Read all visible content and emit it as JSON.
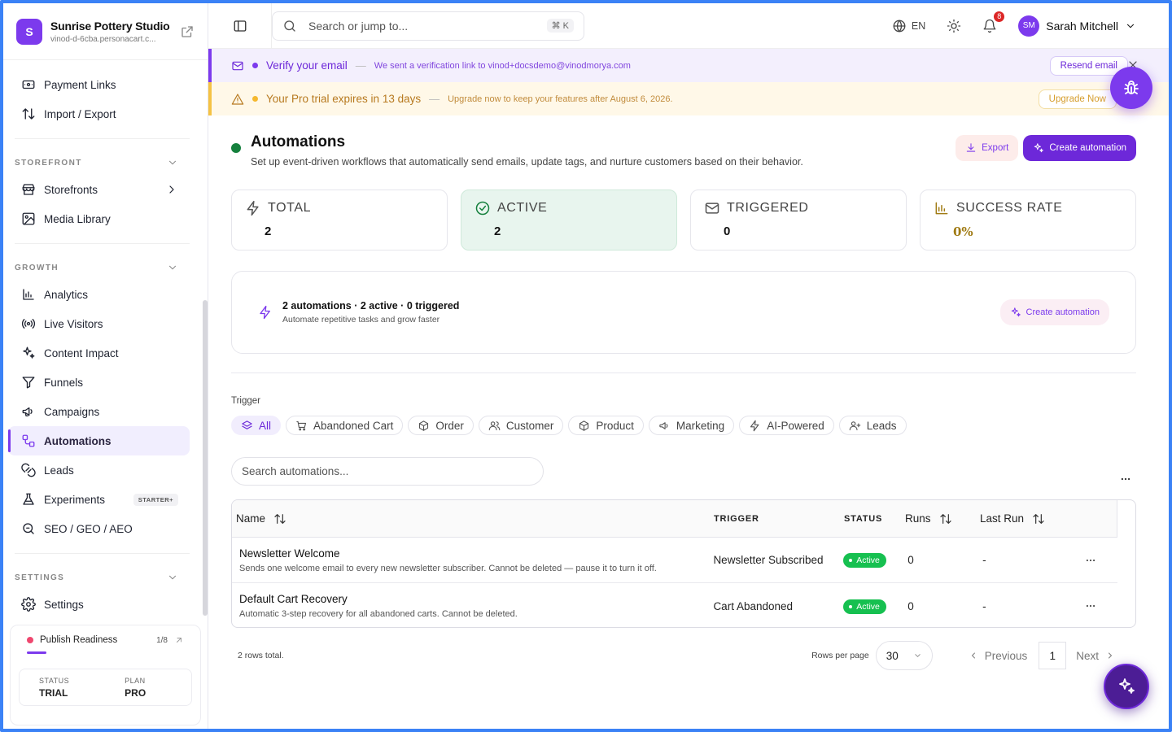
{
  "brand": {
    "initial": "S",
    "name": "Sunrise Pottery Studio",
    "url": "vinod-d-6cba.personacart.c..."
  },
  "sidebar": {
    "top_items": [
      {
        "label": "Payment Links",
        "icon": "payment-link-icon"
      },
      {
        "label": "Import / Export",
        "icon": "arrows-updown-icon"
      }
    ],
    "storefront_label": "STOREFRONT",
    "storefront_items": [
      {
        "label": "Storefronts",
        "icon": "store-icon"
      },
      {
        "label": "Media Library",
        "icon": "image-icon"
      }
    ],
    "growth_label": "GROWTH",
    "growth_items": [
      {
        "label": "Analytics",
        "icon": "bar-chart-icon"
      },
      {
        "label": "Live Visitors",
        "icon": "broadcast-icon"
      },
      {
        "label": "Content Impact",
        "icon": "sparkles-icon"
      },
      {
        "label": "Funnels",
        "icon": "funnel-icon"
      },
      {
        "label": "Campaigns",
        "icon": "megaphone-icon"
      },
      {
        "label": "Automations",
        "icon": "workflow-icon",
        "active": true
      },
      {
        "label": "Leads",
        "icon": "magnet-icon"
      },
      {
        "label": "Experiments",
        "icon": "flask-icon",
        "badge": "STARTER+"
      },
      {
        "label": "SEO / GEO / AEO",
        "icon": "search-icon"
      }
    ],
    "settings_label": "SETTINGS",
    "settings_items": [
      {
        "label": "Settings",
        "icon": "gear-icon"
      }
    ],
    "publish": {
      "title": "Publish Readiness",
      "count": "1/8",
      "status_key": "STATUS",
      "status_val": "TRIAL",
      "plan_key": "PLAN",
      "plan_val": "PRO"
    }
  },
  "topbar": {
    "search_placeholder": "Search or jump to...",
    "shortcut": "⌘ K",
    "language": "EN",
    "notif_count": "8",
    "user_initials": "SM",
    "user_name": "Sarah Mitchell"
  },
  "banners": {
    "verify": {
      "title": "Verify your email",
      "sep": "—",
      "sub": "We sent a verification link to vinod+docsdemo@vinodmorya.com",
      "button": "Resend email"
    },
    "trial": {
      "title": "Your Pro trial expires in 13 days",
      "sep": "—",
      "sub": "Upgrade now to keep your features after August 6, 2026.",
      "button": "Upgrade Now"
    }
  },
  "page": {
    "title": "Automations",
    "subtitle": "Set up event-driven workflows that automatically send emails, update tags, and nurture customers based on their behavior.",
    "export_label": "Export",
    "create_label": "Create automation"
  },
  "stats": [
    {
      "label": "TOTAL",
      "value": "2",
      "icon": "bolt-icon"
    },
    {
      "label": "ACTIVE",
      "value": "2",
      "icon": "check-circle-icon"
    },
    {
      "label": "TRIGGERED",
      "value": "0",
      "icon": "mail-icon"
    },
    {
      "label": "SUCCESS RATE",
      "value": "0%",
      "icon": "bar-chart-icon"
    }
  ],
  "summary": {
    "title": "2 automations · 2 active · 0 triggered",
    "sub": "Automate repetitive tasks and grow faster",
    "button": "Create automation"
  },
  "filters": {
    "label": "Trigger",
    "chips": [
      {
        "label": "All",
        "icon": "layers-icon",
        "selected": true
      },
      {
        "label": "Abandoned Cart",
        "icon": "cart-icon"
      },
      {
        "label": "Order",
        "icon": "box-icon"
      },
      {
        "label": "Customer",
        "icon": "users-icon"
      },
      {
        "label": "Product",
        "icon": "box-icon"
      },
      {
        "label": "Marketing",
        "icon": "megaphone-icon"
      },
      {
        "label": "AI-Powered",
        "icon": "bolt-icon"
      },
      {
        "label": "Leads",
        "icon": "user-plus-icon"
      }
    ],
    "search_placeholder": "Search automations..."
  },
  "table": {
    "columns": {
      "name": "Name",
      "trigger": "TRIGGER",
      "status": "STATUS",
      "runs": "Runs",
      "last_run": "Last Run"
    },
    "rows": [
      {
        "name": "Newsletter Welcome",
        "desc": "Sends one welcome email to every new newsletter subscriber. Cannot be deleted — pause it to turn it off.",
        "trigger": "Newsletter Subscribed",
        "status": "Active",
        "runs": "0",
        "last_run": "-"
      },
      {
        "name": "Default Cart Recovery",
        "desc": "Automatic 3-step recovery for all abandoned carts. Cannot be deleted.",
        "trigger": "Cart Abandoned",
        "status": "Active",
        "runs": "0",
        "last_run": "-"
      }
    ]
  },
  "pagination": {
    "total": "2 rows total.",
    "rows_per_page_label": "Rows per page",
    "rows_per_page": "30",
    "previous": "Previous",
    "page": "1",
    "next": "Next"
  },
  "colors": {
    "accent": "#7c3aed",
    "success": "#16c050",
    "warning": "#f5c244"
  }
}
